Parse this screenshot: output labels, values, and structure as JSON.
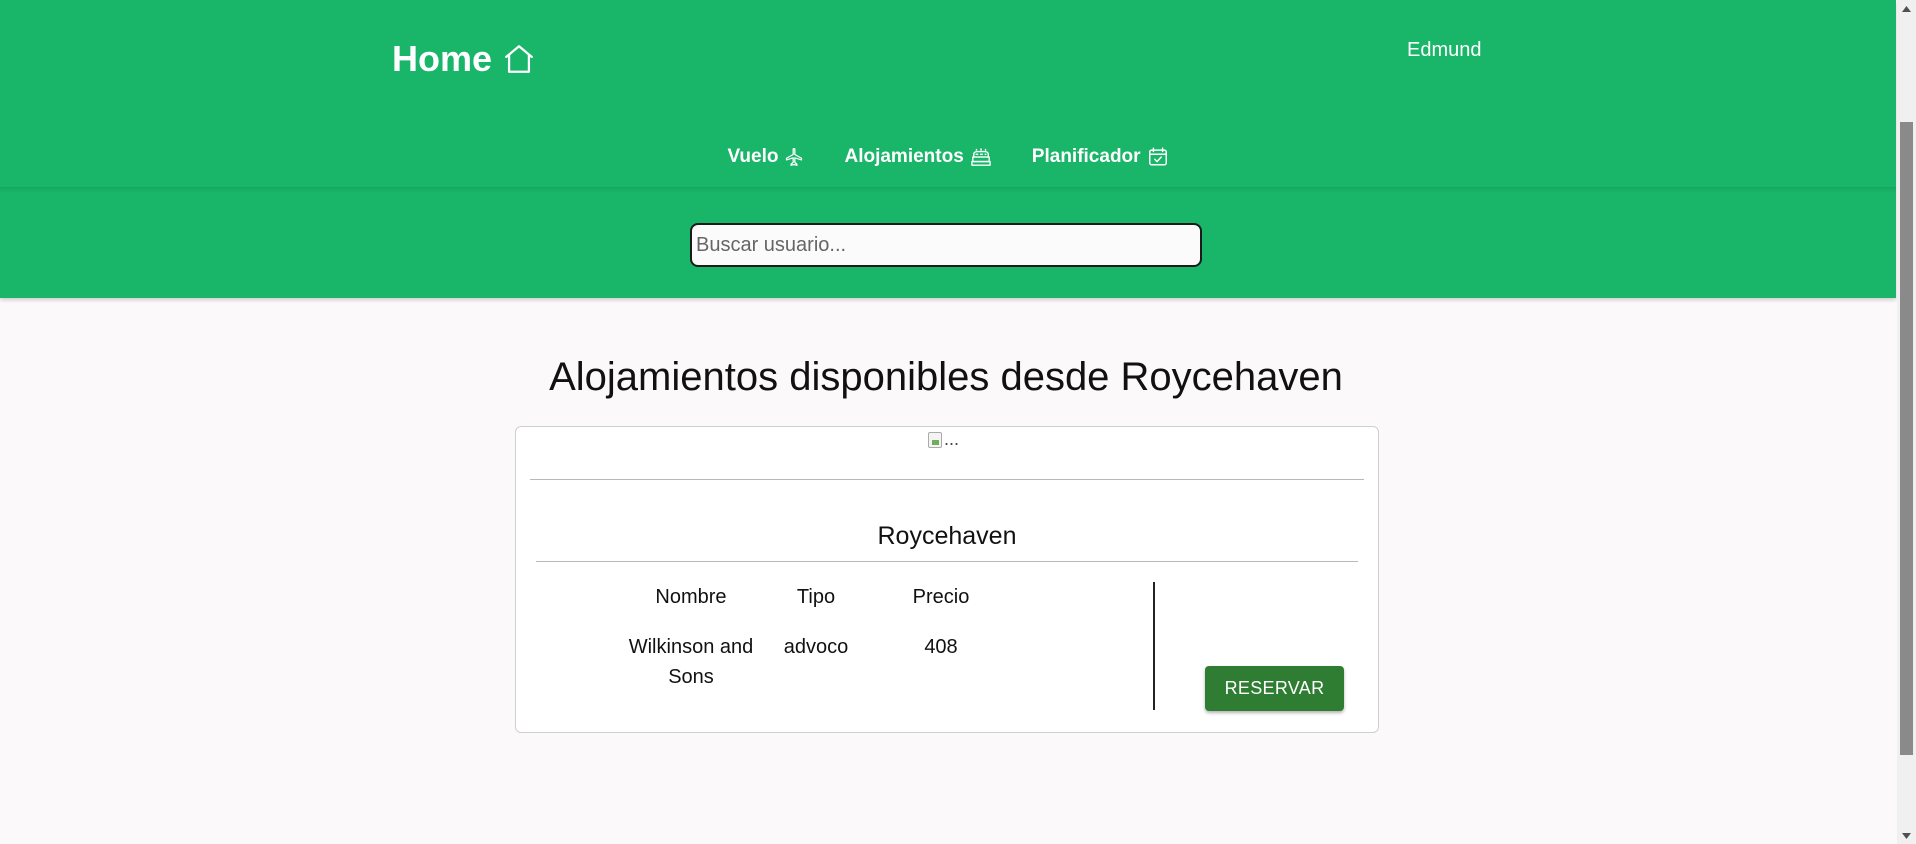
{
  "header": {
    "brand": "Home",
    "user": "Edmund",
    "nav": [
      {
        "label": "Vuelo",
        "icon": "airplane-icon"
      },
      {
        "label": "Alojamientos",
        "icon": "hotel-icon"
      },
      {
        "label": "Planificador",
        "icon": "calendar-check-icon"
      }
    ],
    "search": {
      "placeholder": "Buscar usuario...",
      "value": ""
    }
  },
  "main": {
    "title": "Alojamientos disponibles desde Roycehaven",
    "card": {
      "image_alt": "...",
      "city": "Roycehaven",
      "columns": [
        "Nombre",
        "Tipo",
        "Precio"
      ],
      "rows": [
        {
          "name": "Wilkinson and Sons",
          "type": "advoco",
          "price": "408"
        }
      ],
      "reserve_label": "RESERVAR"
    }
  },
  "colors": {
    "header_bg": "#19b569",
    "button_bg": "#2e7d32"
  }
}
